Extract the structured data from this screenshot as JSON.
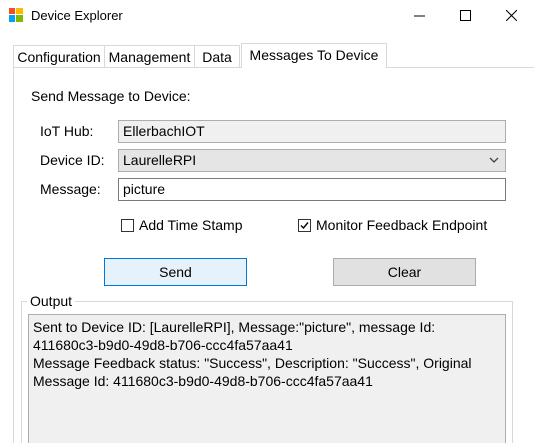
{
  "window": {
    "title": "Device Explorer"
  },
  "tabs": [
    {
      "label": "Configuration",
      "active": false
    },
    {
      "label": "Management",
      "active": false
    },
    {
      "label": "Data",
      "active": false
    },
    {
      "label": "Messages To Device",
      "active": true
    }
  ],
  "form": {
    "heading": "Send Message to Device:",
    "iot_hub_label": "IoT Hub:",
    "iot_hub_value": "EllerbachIOT",
    "device_id_label": "Device ID:",
    "device_id_value": "LaurelleRPI",
    "message_label": "Message:",
    "message_value": "picture",
    "add_timestamp_label": "Add Time Stamp",
    "add_timestamp_checked": false,
    "monitor_feedback_label": "Monitor Feedback Endpoint",
    "monitor_feedback_checked": true,
    "send_label": "Send",
    "clear_label": "Clear"
  },
  "output": {
    "group_label": "Output",
    "text": "Sent to Device ID: [LaurelleRPI], Message:\"picture\", message Id: 411680c3-b9d0-49d8-b706-ccc4fa57aa41\nMessage Feedback status: \"Success\", Description: \"Success\", Original Message Id: 411680c3-b9d0-49d8-b706-ccc4fa57aa41"
  },
  "colors": {
    "send_accent": "#0078d7",
    "readonly_bg": "#f0f0f0"
  }
}
